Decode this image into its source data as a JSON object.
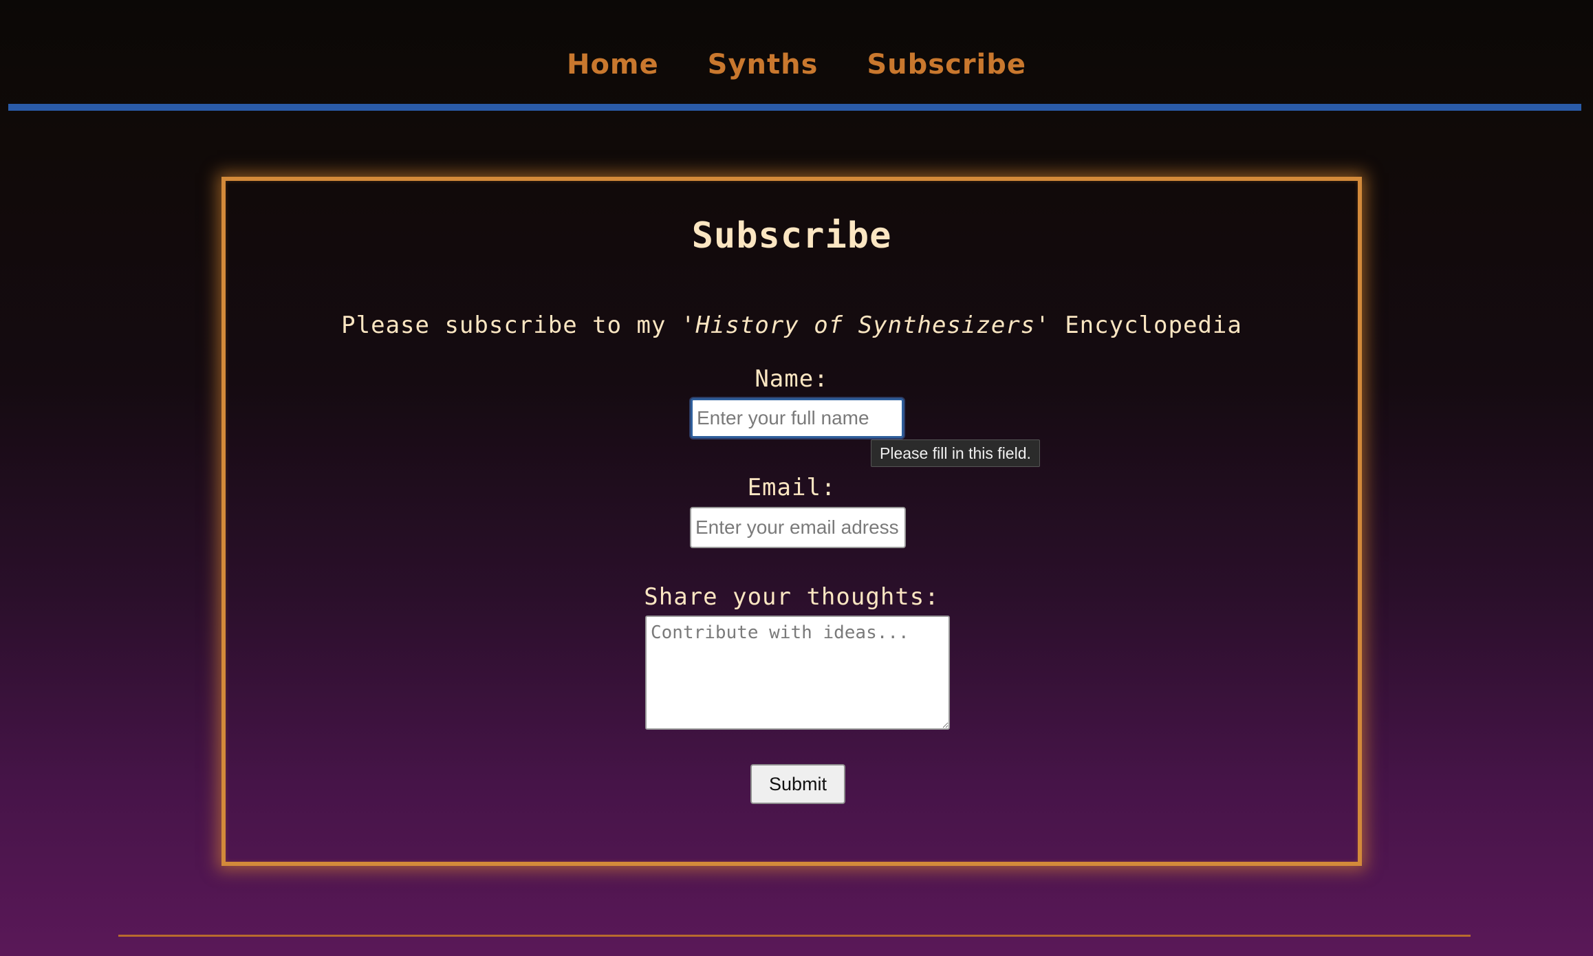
{
  "nav": {
    "items": [
      {
        "label": "Home"
      },
      {
        "label": "Synths"
      },
      {
        "label": "Subscribe"
      }
    ]
  },
  "form": {
    "title": "Subscribe",
    "intro_prefix": "Please subscribe to my ",
    "intro_emphasis": "'History of Synthesizers'",
    "intro_suffix": " Encyclopedia",
    "name_label": "Name:",
    "name_placeholder": "Enter your full name",
    "name_value": "",
    "email_label": "Email:",
    "email_placeholder": "Enter your email adress",
    "email_value": "",
    "thoughts_label": "Share your thoughts:",
    "thoughts_placeholder": "Contribute with ideas...",
    "thoughts_value": "",
    "submit_label": "Submit"
  },
  "validation": {
    "tooltip_text": "Please fill in this field."
  },
  "colors": {
    "nav_link": "#c9782e",
    "nav_rule": "#2a5ba8",
    "card_border": "#d38a3a",
    "text_cream": "#fbe6c2",
    "footer_rule": "#b86b2e"
  }
}
